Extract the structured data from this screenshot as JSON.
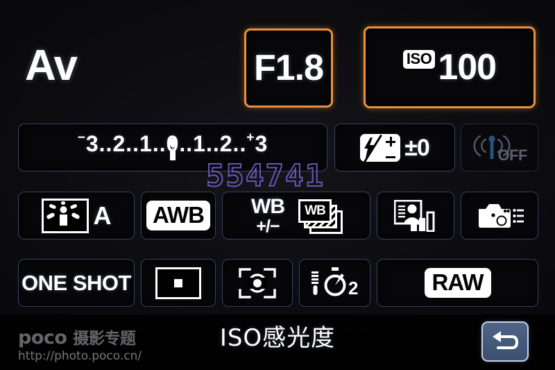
{
  "screen": {
    "name": "Canon Quick Control Screen",
    "accent_highlight": "#e8913d",
    "cell_border": "#3a3f63",
    "back_button_color": "#4e6387"
  },
  "top": {
    "shooting_mode": "Av",
    "aperture": "F1.8",
    "iso_badge": "ISO",
    "iso_value": "100"
  },
  "exposure": {
    "minus_sign": "−",
    "plus_sign": "+",
    "scale": "3..2..1..0..1..2..3",
    "scale_left": "3..2..1..",
    "scale_right": "..1..2..",
    "scale_center": "0",
    "scale_end": "3",
    "value": "0"
  },
  "flash": {
    "label": "flash-exposure-compensation",
    "value": "±0"
  },
  "wireless": {
    "status": "OFF"
  },
  "picture_style": {
    "value": "A"
  },
  "white_balance": {
    "mode": "AWB",
    "shift_line1": "WB",
    "shift_line2": "+/−",
    "bracket_label": "WB"
  },
  "auto_lighting_optimizer": {
    "name": "auto-lighting-optimizer"
  },
  "custom_controls": {
    "name": "custom-controls"
  },
  "af": {
    "mode": "ONE SHOT",
    "area": "single-point-af"
  },
  "metering": {
    "mode": "evaluative-metering"
  },
  "drive": {
    "mode": "self-timer",
    "seconds": "2"
  },
  "quality": {
    "value": "RAW"
  },
  "bottom": {
    "help_text": "ISO感光度",
    "back_label": "return"
  },
  "watermark": {
    "brand": "poco",
    "brand_cn": "摄影专题",
    "url": "http://photo.poco.cn/",
    "number": "554741"
  }
}
